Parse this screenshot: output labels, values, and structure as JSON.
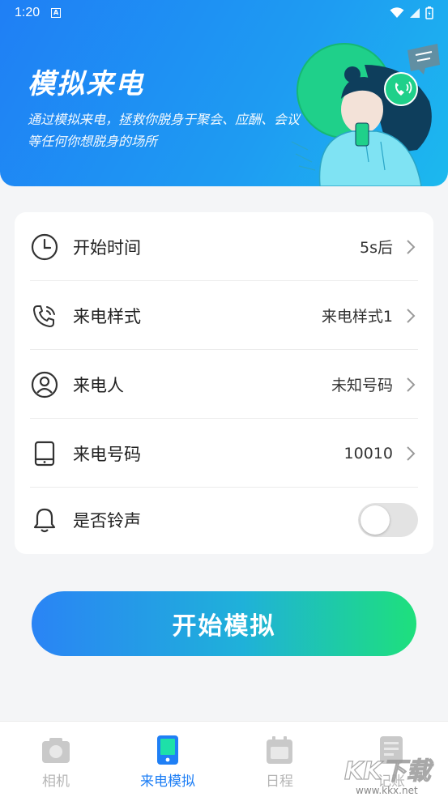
{
  "status_bar": {
    "time": "1:20",
    "notification_glyph": "A"
  },
  "hero": {
    "title": "模拟来电",
    "description": "通过模拟来电，拯救你脱身于聚会、应酬、会议等任何你想脱身的场所"
  },
  "settings": {
    "rows": [
      {
        "icon": "clock-icon",
        "label": "开始时间",
        "value": "5s后"
      },
      {
        "icon": "phone-call-icon",
        "label": "来电样式",
        "value": "来电样式1"
      },
      {
        "icon": "user-icon",
        "label": "来电人",
        "value": "未知号码"
      },
      {
        "icon": "tablet-icon",
        "label": "来电号码",
        "value": "10010"
      },
      {
        "icon": "bell-icon",
        "label": "是否铃声",
        "toggle_on": false
      }
    ]
  },
  "start_button": {
    "label": "开始模拟"
  },
  "tabbar": {
    "tabs": [
      {
        "icon": "camera-icon",
        "label": "相机",
        "active": false
      },
      {
        "icon": "phone-screen-icon",
        "label": "来电模拟",
        "active": true
      },
      {
        "icon": "calendar-icon",
        "label": "日程",
        "active": false
      },
      {
        "icon": "notebook-icon",
        "label": "记账",
        "active": false
      }
    ]
  },
  "watermark": {
    "text": "KK下载",
    "url_text": "www.kkx.net"
  },
  "colors": {
    "accent": "#1f7ff5",
    "gradient_start": "#2a84f5",
    "gradient_end": "#1ee07c",
    "inactive": "#b5b5b5"
  }
}
